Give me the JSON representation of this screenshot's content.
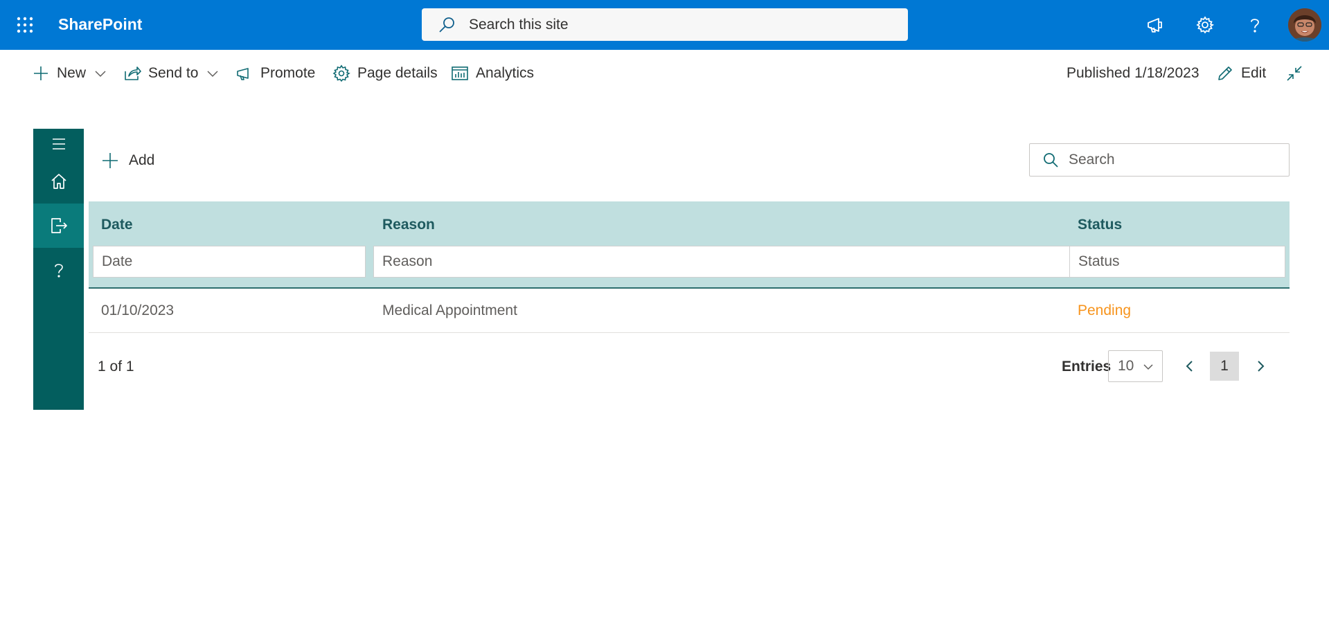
{
  "suite": {
    "brand": "SharePoint",
    "search_placeholder": "Search this site",
    "colors": {
      "bar": "#0078d4"
    },
    "icons": [
      "app-launcher-icon",
      "megaphone-icon",
      "gear-icon",
      "help-icon"
    ]
  },
  "commandbar": {
    "new_label": "New",
    "send_to_label": "Send to",
    "promote_label": "Promote",
    "page_details_label": "Page details",
    "analytics_label": "Analytics",
    "published_text": "Published 1/18/2023",
    "edit_label": "Edit"
  },
  "leftnav": {
    "items": [
      "menu-icon",
      "home-icon",
      "sign-out-icon",
      "help-icon"
    ],
    "active_item": "sign-out-icon",
    "colors": {
      "background": "#035e5e",
      "active": "#0a7b7b"
    }
  },
  "list": {
    "add_label": "Add",
    "search_placeholder": "Search",
    "columns": [
      "Date",
      "Reason",
      "Status"
    ],
    "filters": {
      "date": "Date",
      "reason": "Reason",
      "status": "Status"
    },
    "rows": [
      {
        "date": "01/10/2023",
        "reason": "Medical Appointment",
        "status": "Pending"
      }
    ],
    "status_colors": {
      "Pending": "#f7941d"
    },
    "header_color": "#c0dfdf"
  },
  "footer": {
    "count_text": "1 of 1",
    "entries_label": "Entries",
    "entries_value": "10",
    "current_page": "1"
  }
}
